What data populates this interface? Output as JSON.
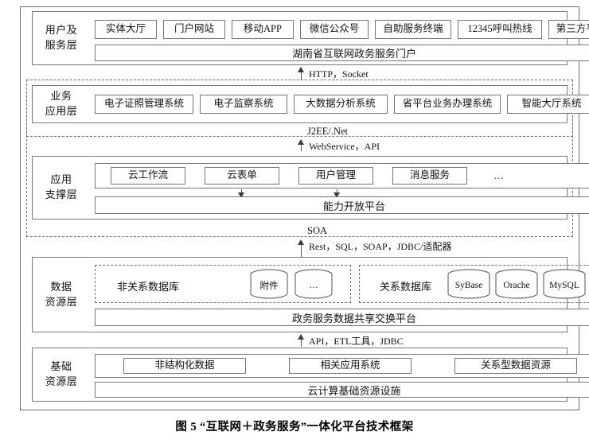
{
  "figure": {
    "caption": "图 5  “互联网＋政务服务”一体化平台技术框架"
  },
  "layers": [
    {
      "id": "user-service",
      "label_line1": "用户及",
      "label_line2": "服务层",
      "items": [
        "实体大厅",
        "门户网站",
        "移动APP",
        "微信公众号",
        "自助服务终端",
        "12345呼叫热线",
        "第三方平台"
      ],
      "bar": "湖南省互联网政务服务门户"
    },
    {
      "id": "business-app",
      "label_line1": "业务",
      "label_line2": "应用层",
      "items": [
        "电子证照管理系统",
        "电子监察系统",
        "大数据分析系统",
        "省平台业务办理系统",
        "智能大厅系统"
      ],
      "group_label": "J2EE/.Net"
    },
    {
      "id": "app-support",
      "label_line1": "应用",
      "label_line2": "支撑层",
      "items": [
        "云工作流",
        "云表单",
        "用户管理",
        "消息服务"
      ],
      "items_more": "…",
      "bar": "能力开放平台",
      "group_label": "SOA"
    },
    {
      "id": "data-resource",
      "label_line1": "数据",
      "label_line2": "资源层",
      "nosql": {
        "label": "非关系数据库",
        "stores": [
          "附件",
          "…"
        ]
      },
      "sql": {
        "label": "关系数据库",
        "stores": [
          "SyBase",
          "Orache",
          "MySQL"
        ],
        "more": "…"
      },
      "bar": "政务服务数据共享交换平台"
    },
    {
      "id": "infra-resource",
      "label_line1": "基础",
      "label_line2": "资源层",
      "items": [
        "非结构化数据",
        "相关应用系统",
        "关系型数据资源"
      ],
      "bar": "云计算基础资源设施"
    }
  ],
  "connectors": [
    {
      "id": "http-socket",
      "label": "HTTP，Socket"
    },
    {
      "id": "webservice-api",
      "label": "WebService，API"
    },
    {
      "id": "rest-sql-soap-jdbc",
      "label": "Rest，SQL，SOAP，JDBC/适配器"
    },
    {
      "id": "api-etl-jdbc",
      "label": "API，ETL工具，JDBC"
    }
  ],
  "colors": {
    "stroke": "#767676",
    "frame": "#6f6f6f",
    "arrow": "#3b3b3b",
    "background": "#ffffff",
    "text": "#111111"
  }
}
